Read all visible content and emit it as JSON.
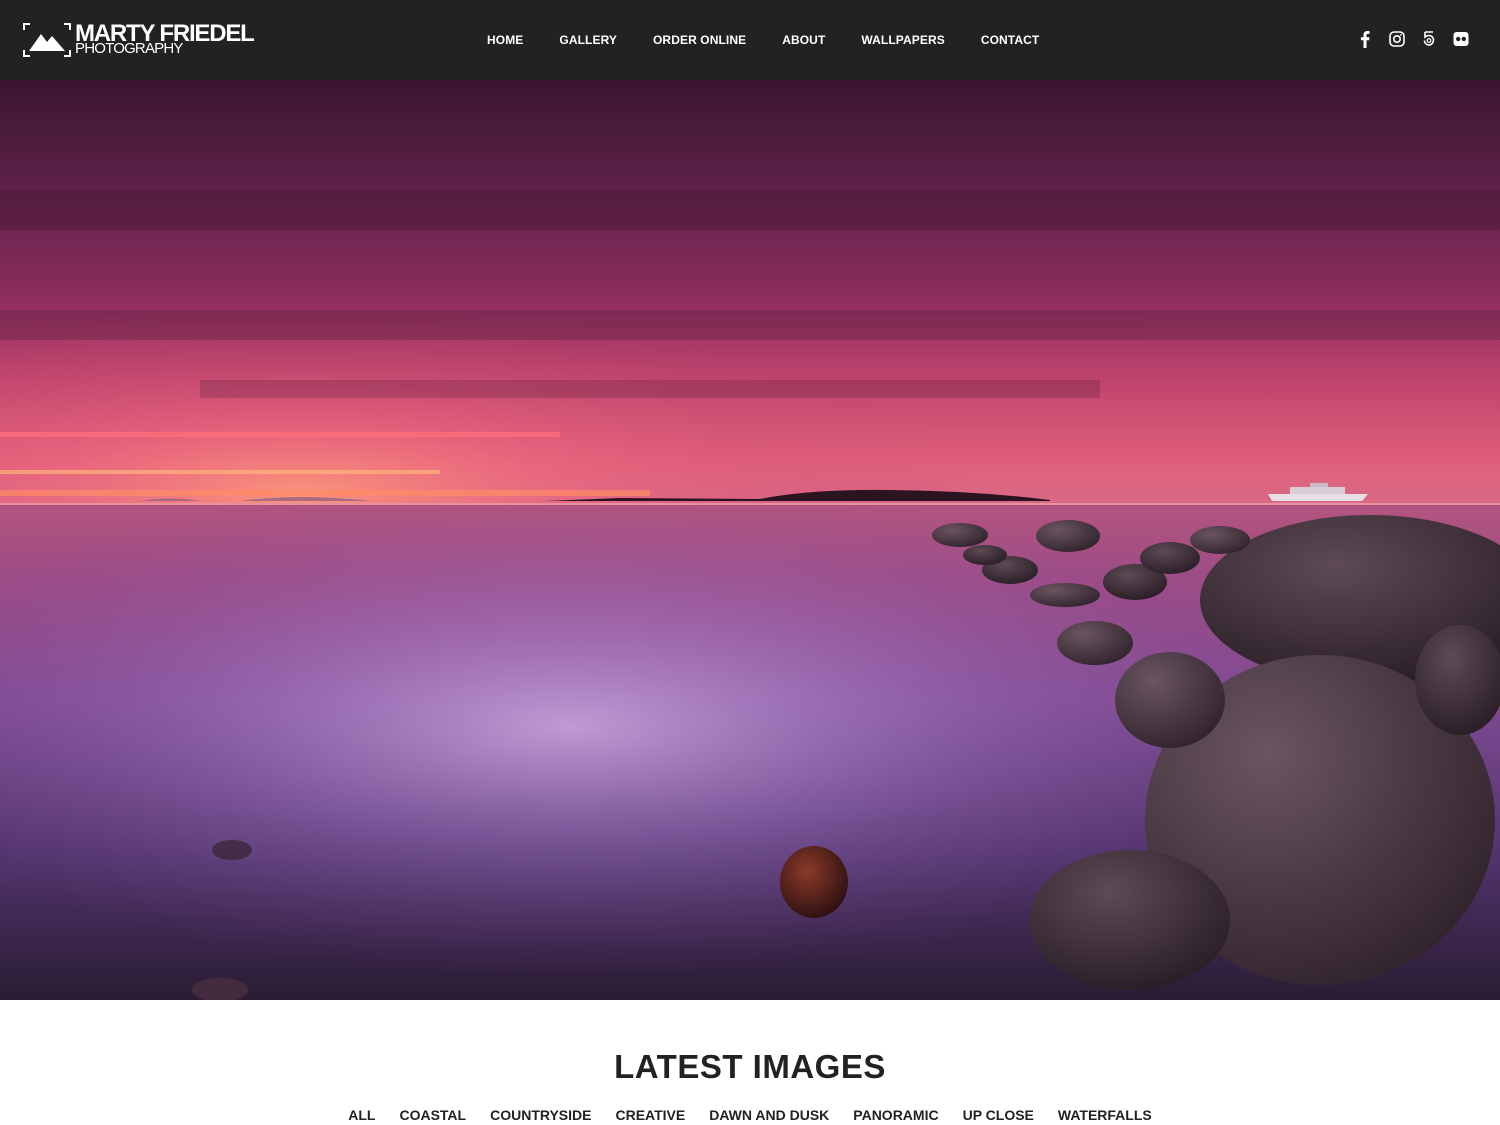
{
  "brand": {
    "title": "MARTY FRIEDEL",
    "subtitle": "PHOTOGRAPHY"
  },
  "nav": {
    "items": [
      "HOME",
      "GALLERY",
      "ORDER ONLINE",
      "ABOUT",
      "WALLPAPERS",
      "CONTACT"
    ]
  },
  "social": {
    "icons": [
      "facebook-icon",
      "instagram-icon",
      "500px-icon",
      "flickr-icon"
    ]
  },
  "colors": {
    "header_bg": "#242122",
    "header_text": "#ffffff",
    "heading_text": "#222222",
    "page_bg": "#ffffff"
  },
  "latest": {
    "title": "LATEST IMAGES",
    "filters": [
      "ALL",
      "COASTAL",
      "COUNTRYSIDE",
      "CREATIVE",
      "DAWN AND DUSK",
      "PANORAMIC",
      "UP CLOSE",
      "WATERFALLS"
    ]
  }
}
